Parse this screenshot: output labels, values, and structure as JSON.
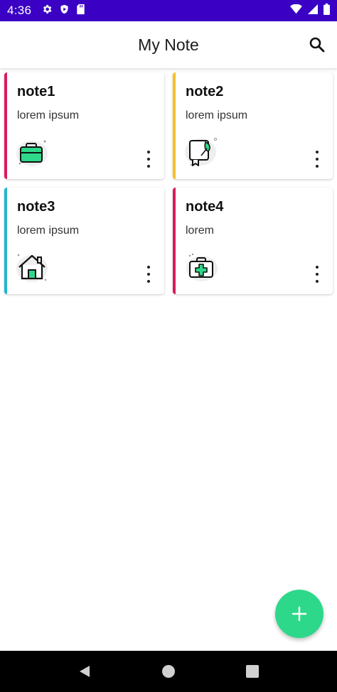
{
  "status_bar": {
    "time": "4:36",
    "background_color": "#3a00c4",
    "left_icons": [
      "settings-icon",
      "shield-play-icon",
      "sd-card-icon"
    ],
    "right_icons": [
      "wifi-icon",
      "cellular-signal-icon",
      "battery-icon"
    ]
  },
  "app_bar": {
    "title": "My Note",
    "search_icon": "search-icon"
  },
  "notes": [
    {
      "title": "note1",
      "body": "lorem ipsum",
      "accent_color": "#d81b60",
      "icon": "briefcase-icon"
    },
    {
      "title": "note2",
      "body": "lorem ipsum",
      "accent_color": "#f6c026",
      "icon": "book-leaf-icon"
    },
    {
      "title": "note3",
      "body": "lorem ipsum",
      "accent_color": "#1fb7cf",
      "icon": "house-icon"
    },
    {
      "title": "note4",
      "body": "lorem",
      "accent_color": "#d81b60",
      "icon": "medical-kit-icon"
    }
  ],
  "fab": {
    "icon": "plus-icon",
    "color": "#2ed88a"
  },
  "nav_bar": {
    "buttons": [
      "back-icon",
      "home-icon",
      "recents-icon"
    ]
  }
}
